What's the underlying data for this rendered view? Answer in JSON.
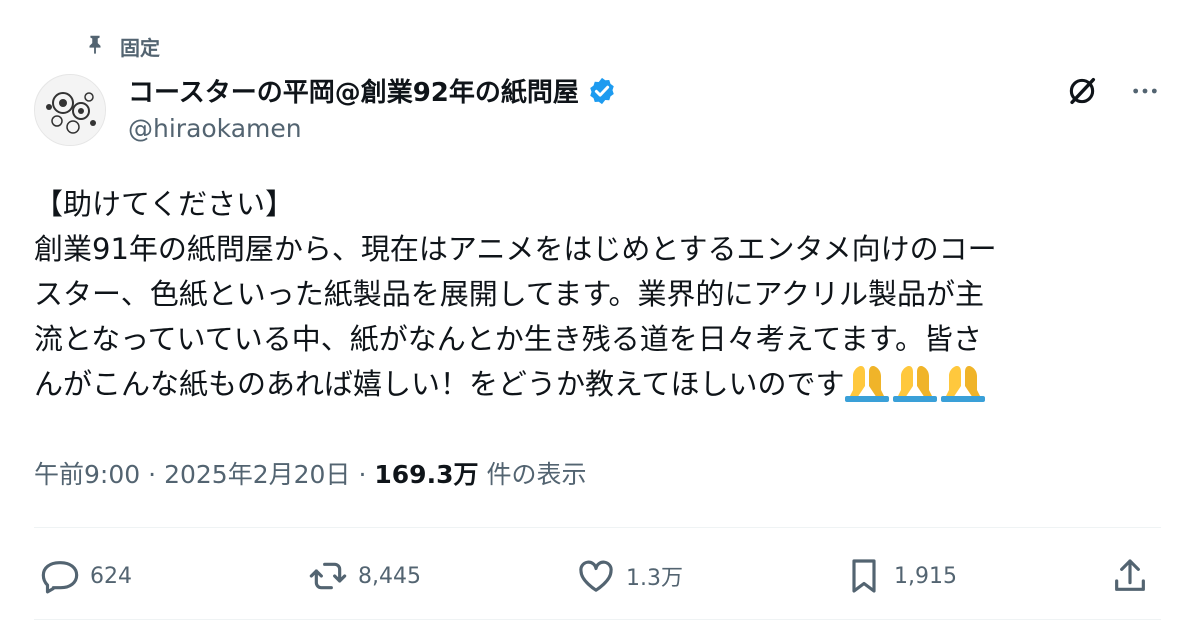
{
  "pinned": {
    "label": "固定",
    "icon": "pin-icon"
  },
  "author": {
    "display_name": "コースターの平岡@創業92年の紙問屋",
    "handle": "@hiraokamen",
    "verified": true,
    "avatar": "avatar-image"
  },
  "top_actions": {
    "grok": "grok-icon",
    "more": "more-icon"
  },
  "post": {
    "lines": [
      "【助けてください】",
      "創業91年の紙問屋から、現在はアニメをはじめとするエンタメ向けのコー",
      "スター、色紙といった紙製品を展開してます。業界的にアクリル製品が主",
      "流となっていている中、紙がなんとか生き残る道を日々考えてます。皆さ",
      "んがこんな紙ものあれば嬉しい！をどうか教えてほしいのです"
    ],
    "emoji": "folded-hands-emoji"
  },
  "meta": {
    "time": "午前9:00",
    "date": "2025年2月20日",
    "separator": "·",
    "views_count": "169.3万",
    "views_label": "件の表示"
  },
  "actions": {
    "reply": "624",
    "repost": "8,445",
    "like": "1.3万",
    "bookmark": "1,915"
  },
  "colors": {
    "text": "#0f1419",
    "secondary": "#536471",
    "verified": "#1d9bf0",
    "divider": "#eff3f4"
  }
}
